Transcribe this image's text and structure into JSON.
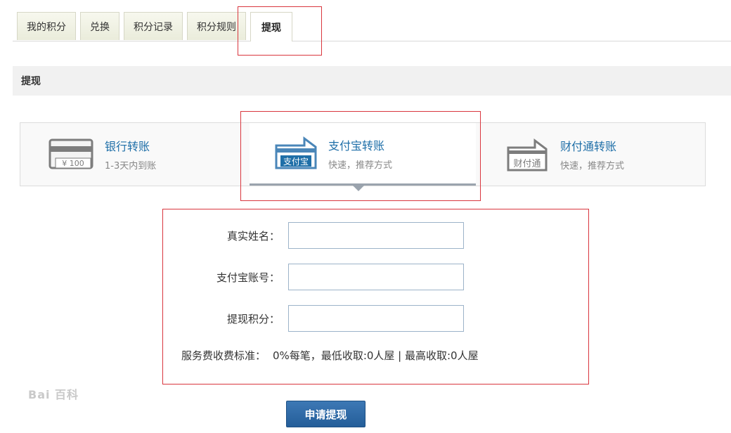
{
  "tabs": [
    "我的积分",
    "兑换",
    "积分记录",
    "积分规则",
    "提现"
  ],
  "active_tab": "提现",
  "section_title": "提现",
  "methods": [
    {
      "title": "银行转账",
      "subtitle": "1-3天内到账",
      "icon": "bank-card-icon",
      "icon_text": "¥ 100"
    },
    {
      "title": "支付宝转账",
      "subtitle": "快速，推荐方式",
      "icon": "alipay-icon",
      "icon_text": "支付宝"
    },
    {
      "title": "财付通转账",
      "subtitle": "快速，推荐方式",
      "icon": "tenpay-icon",
      "icon_text": "财付通"
    }
  ],
  "form": {
    "real_name_label": "真实姓名：",
    "real_name_value": "",
    "alipay_account_label": "支付宝账号：",
    "alipay_account_value": "",
    "points_label": "提现积分：",
    "points_value": "",
    "fee_label": "服务费收费标准：",
    "fee_value": "0%每笔，最低收取:0人屋 | 最高收取:0人屋"
  },
  "submit_label": "申请提现",
  "watermark": "Bai 百科",
  "colors": {
    "accent": "#1f6fa8",
    "annotation": "#d9363e",
    "button": "#2f6aa8"
  }
}
